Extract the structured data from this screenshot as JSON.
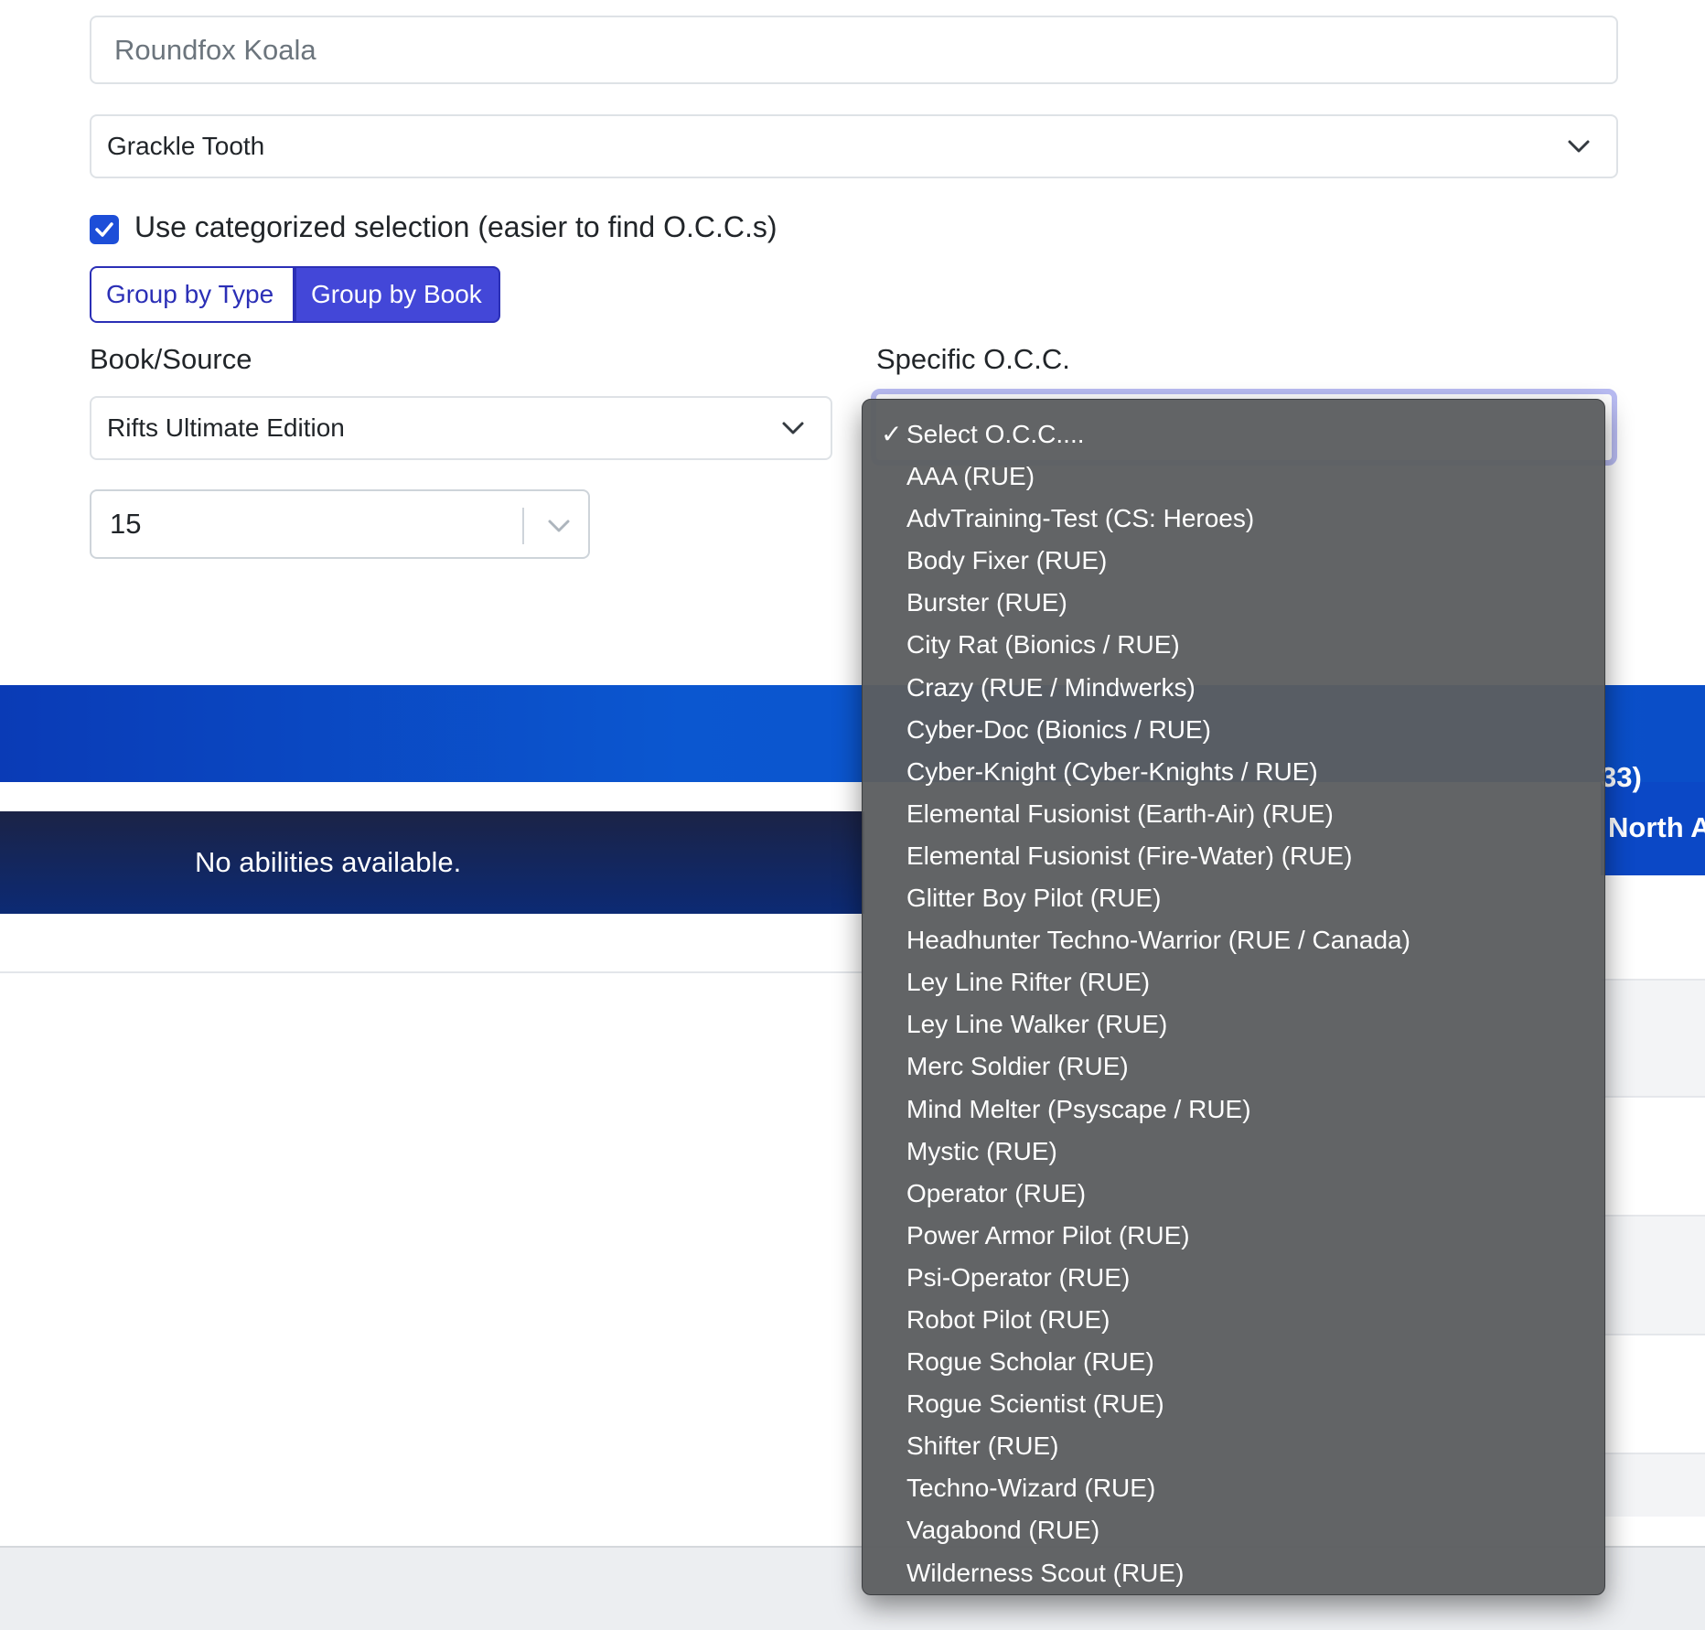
{
  "form": {
    "name_value": "Roundfox Koala",
    "character_select_value": "Grackle Tooth",
    "use_categorized_label": "Use categorized selection (easier to find O.C.C.s)",
    "use_categorized_checked": true,
    "group_by_type_label": "Group by Type",
    "group_by_book_label": "Group by Book",
    "book_source_label": "Book/Source",
    "book_source_value": "Rifts Ultimate Edition",
    "specific_occ_label": "Specific O.C.C.",
    "level_value": "15"
  },
  "background": {
    "no_abilities_text": "No abilities available.",
    "right_fragment_1": "33)",
    "right_fragment_2": "North A"
  },
  "dropdown": {
    "selected_index": 0,
    "checkmark": "✓",
    "options": [
      "Select O.C.C....",
      "AAA (RUE)",
      "AdvTraining-Test (CS: Heroes)",
      "Body Fixer (RUE)",
      "Burster (RUE)",
      "City Rat (Bionics / RUE)",
      "Crazy (RUE / Mindwerks)",
      "Cyber-Doc (Bionics / RUE)",
      "Cyber-Knight (Cyber-Knights / RUE)",
      "Elemental Fusionist (Earth-Air) (RUE)",
      "Elemental Fusionist (Fire-Water) (RUE)",
      "Glitter Boy Pilot (RUE)",
      "Headhunter Techno-Warrior (RUE / Canada)",
      "Ley Line Rifter (RUE)",
      "Ley Line Walker (RUE)",
      "Merc Soldier (RUE)",
      "Mind Melter (Psyscape / RUE)",
      "Mystic (RUE)",
      "Operator (RUE)",
      "Power Armor Pilot (RUE)",
      "Psi-Operator (RUE)",
      "Robot Pilot (RUE)",
      "Rogue Scholar (RUE)",
      "Rogue Scientist (RUE)",
      "Shifter (RUE)",
      "Techno-Wizard (RUE)",
      "Vagabond (RUE)",
      "Wilderness Scout (RUE)"
    ]
  },
  "colors": {
    "accent": "#4347d8",
    "accent_border": "#2b2fb6",
    "checkbox": "#1d4ed8",
    "blue_bar": "#0b57d0",
    "navy_bar": "#0c2a74",
    "dropdown_bg": "#5c5e60"
  },
  "icons": {
    "chevron": "chevron-down-icon",
    "check": "checkmark-icon"
  }
}
